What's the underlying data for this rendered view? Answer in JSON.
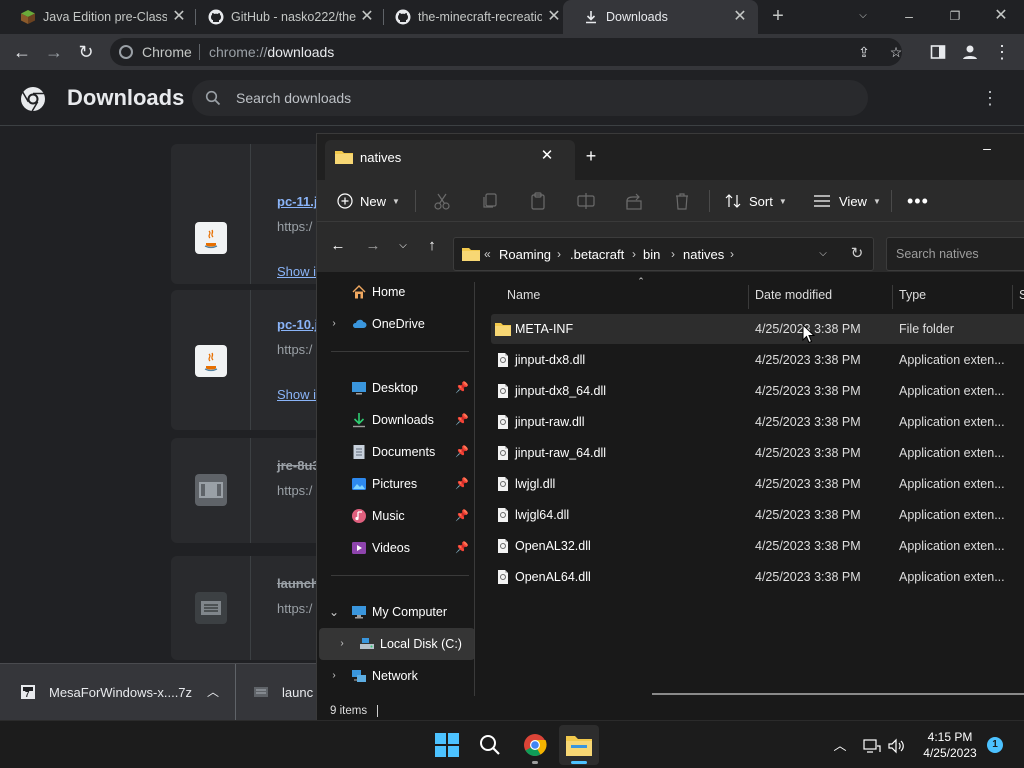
{
  "colors": {
    "chrome_bg": "#202124",
    "chrome_toolbar": "#35363a",
    "chrome_link": "#8ab4f8",
    "explorer_bg": "#191919",
    "explorer_bar": "#2b2b2b",
    "folder_yellow": "#f2c94c",
    "taskbar": "#1c1c1c",
    "accent": "#4cc2ff"
  },
  "chrome": {
    "tabs": [
      {
        "title": "Java Edition pre-Classic",
        "icon": "minecraft-icon"
      },
      {
        "title": "GitHub - nasko222/the",
        "icon": "github-icon"
      },
      {
        "title": "the-minecraft-recreatio",
        "icon": "github-icon"
      },
      {
        "title": "Downloads",
        "icon": "download-icon"
      }
    ],
    "omnibox": {
      "site": "Chrome",
      "url_prefix": "chrome://",
      "url_main": "downloads"
    }
  },
  "downloads_page": {
    "title": "Downloads",
    "search_placeholder": "Search downloads",
    "cards": [
      {
        "name": "pc-11.j",
        "url": "https:/",
        "link": "Show i",
        "icon": "java-icon",
        "removed": false
      },
      {
        "name": "pc-10.j",
        "url": "https:/",
        "link": "Show i",
        "icon": "java-icon",
        "removed": false
      },
      {
        "name": "jre-8u3",
        "url": "https:/",
        "link": "",
        "icon": "file-icon",
        "removed": true
      },
      {
        "name": "launch",
        "url": "https:/",
        "link": "",
        "icon": "betacraft-icon",
        "removed": true
      }
    ]
  },
  "shelf": {
    "items": [
      {
        "name": "MesaForWindows-x....7z",
        "icon": "archive-icon"
      },
      {
        "name": "launc",
        "icon": "betacraft-icon"
      }
    ]
  },
  "explorer": {
    "tab_title": "natives",
    "commands": {
      "new": "New",
      "sort": "Sort",
      "view": "View"
    },
    "breadcrumb": [
      "Roaming",
      ".betacraft",
      "bin",
      "natives"
    ],
    "search_placeholder": "Search natives",
    "nav": [
      {
        "label": "Home",
        "icon": "home-icon",
        "expandable": false,
        "pinned": false
      },
      {
        "label": "OneDrive",
        "icon": "cloud-icon",
        "expandable": true,
        "pinned": false
      },
      {
        "label": "Desktop",
        "icon": "desktop-icon",
        "expandable": false,
        "pinned": true
      },
      {
        "label": "Downloads",
        "icon": "download-icon",
        "expandable": false,
        "pinned": true
      },
      {
        "label": "Documents",
        "icon": "documents-icon",
        "expandable": false,
        "pinned": true
      },
      {
        "label": "Pictures",
        "icon": "pictures-icon",
        "expandable": false,
        "pinned": true
      },
      {
        "label": "Music",
        "icon": "music-icon",
        "expandable": false,
        "pinned": true
      },
      {
        "label": "Videos",
        "icon": "videos-icon",
        "expandable": false,
        "pinned": true
      },
      {
        "label": "My Computer",
        "icon": "computer-icon",
        "expandable": true,
        "pinned": false
      },
      {
        "label": "Local Disk (C:)",
        "icon": "drive-icon",
        "expandable": true,
        "pinned": false
      },
      {
        "label": "Network",
        "icon": "network-icon",
        "expandable": true,
        "pinned": false
      }
    ],
    "columns": {
      "name": "Name",
      "date": "Date modified",
      "type": "Type",
      "size": "S"
    },
    "files": [
      {
        "name": "META-INF",
        "date": "4/25/2023 3:38 PM",
        "type": "File folder",
        "kind": "folder"
      },
      {
        "name": "jinput-dx8.dll",
        "date": "4/25/2023 3:38 PM",
        "type": "Application exten...",
        "kind": "dll"
      },
      {
        "name": "jinput-dx8_64.dll",
        "date": "4/25/2023 3:38 PM",
        "type": "Application exten...",
        "kind": "dll"
      },
      {
        "name": "jinput-raw.dll",
        "date": "4/25/2023 3:38 PM",
        "type": "Application exten...",
        "kind": "dll"
      },
      {
        "name": "jinput-raw_64.dll",
        "date": "4/25/2023 3:38 PM",
        "type": "Application exten...",
        "kind": "dll"
      },
      {
        "name": "lwjgl.dll",
        "date": "4/25/2023 3:38 PM",
        "type": "Application exten...",
        "kind": "dll"
      },
      {
        "name": "lwjgl64.dll",
        "date": "4/25/2023 3:38 PM",
        "type": "Application exten...",
        "kind": "dll"
      },
      {
        "name": "OpenAL32.dll",
        "date": "4/25/2023 3:38 PM",
        "type": "Application exten...",
        "kind": "dll"
      },
      {
        "name": "OpenAL64.dll",
        "date": "4/25/2023 3:38 PM",
        "type": "Application exten...",
        "kind": "dll"
      }
    ],
    "status": "9 items"
  },
  "taskbar": {
    "apps": [
      {
        "name": "start",
        "icon": "windows-start-icon"
      },
      {
        "name": "search",
        "icon": "search-icon"
      },
      {
        "name": "chrome",
        "icon": "chrome-icon"
      },
      {
        "name": "explorer",
        "icon": "file-explorer-icon"
      }
    ],
    "time": "4:15 PM",
    "date": "4/25/2023",
    "notifications": "1"
  }
}
